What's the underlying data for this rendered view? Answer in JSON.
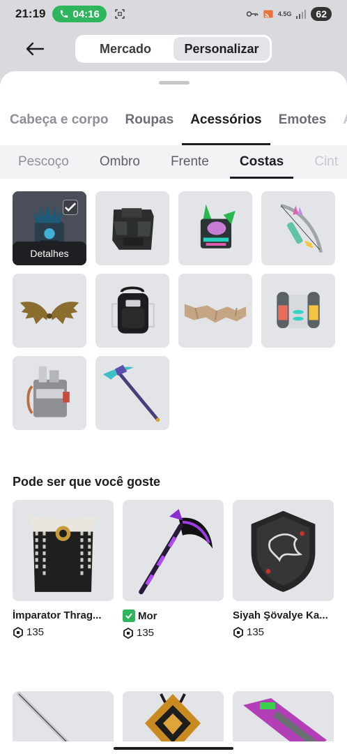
{
  "status_bar": {
    "time": "21:19",
    "call_timer": "04:16",
    "network": "4.5G",
    "battery": "62"
  },
  "header": {
    "back_icon": "arrow-left-icon",
    "segments": [
      {
        "label": "Mercado",
        "active": false
      },
      {
        "label": "Personalizar",
        "active": true
      }
    ]
  },
  "category_tabs": [
    {
      "label": "Cabeça e corpo",
      "active": false
    },
    {
      "label": "Roupas",
      "active": false
    },
    {
      "label": "Acessórios",
      "active": true
    },
    {
      "label": "Emotes",
      "active": false
    },
    {
      "label": "A",
      "active": false
    }
  ],
  "sub_tabs": [
    {
      "label": "Pescoço",
      "active": false
    },
    {
      "label": "Ombro",
      "active": false
    },
    {
      "label": "Frente",
      "active": false
    },
    {
      "label": "Costas",
      "active": true
    },
    {
      "label": "Cint",
      "active": false
    }
  ],
  "equipped_item": {
    "details_label": "Detalhes"
  },
  "recommendations": {
    "title": "Pode ser que você goste",
    "items": [
      {
        "name": "İmparator Thrag...",
        "price": "135",
        "verified": false
      },
      {
        "name": "Mor",
        "price": "135",
        "verified": true
      },
      {
        "name": "Siyah Şövalye Ka...",
        "price": "135",
        "verified": false
      }
    ]
  },
  "colors": {
    "accent_dark": "#1c1d20",
    "tile_bg": "#e3e4e8",
    "call_green": "#2fb55c"
  }
}
